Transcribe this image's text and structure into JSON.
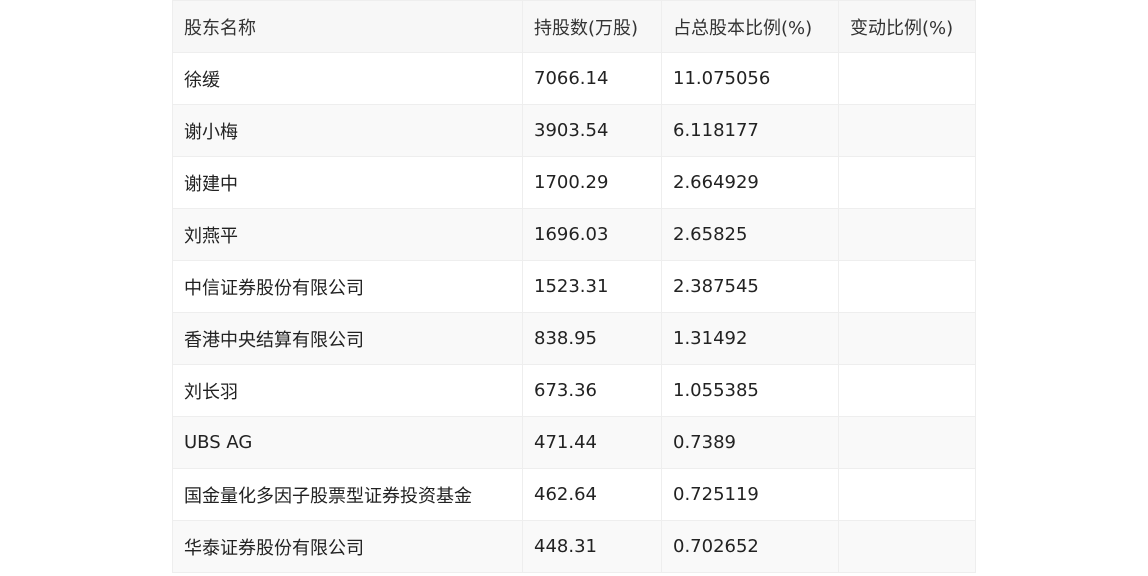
{
  "table": {
    "headers": [
      "股东名称",
      "持股数(万股)",
      "占总股本比例(%)",
      "变动比例(%)"
    ],
    "rows": [
      [
        "徐缓",
        "7066.14",
        "11.075056",
        ""
      ],
      [
        "谢小梅",
        "3903.54",
        "6.118177",
        ""
      ],
      [
        "谢建中",
        "1700.29",
        "2.664929",
        ""
      ],
      [
        "刘燕平",
        "1696.03",
        "2.65825",
        ""
      ],
      [
        "中信证券股份有限公司",
        "1523.31",
        "2.387545",
        ""
      ],
      [
        "香港中央结算有限公司",
        "838.95",
        "1.31492",
        ""
      ],
      [
        "刘长羽",
        "673.36",
        "1.055385",
        ""
      ],
      [
        "UBS AG",
        "471.44",
        "0.7389",
        ""
      ],
      [
        "国金量化多因子股票型证券投资基金",
        "462.64",
        "0.725119",
        ""
      ],
      [
        "华泰证券股份有限公司",
        "448.31",
        "0.702652",
        ""
      ]
    ]
  }
}
